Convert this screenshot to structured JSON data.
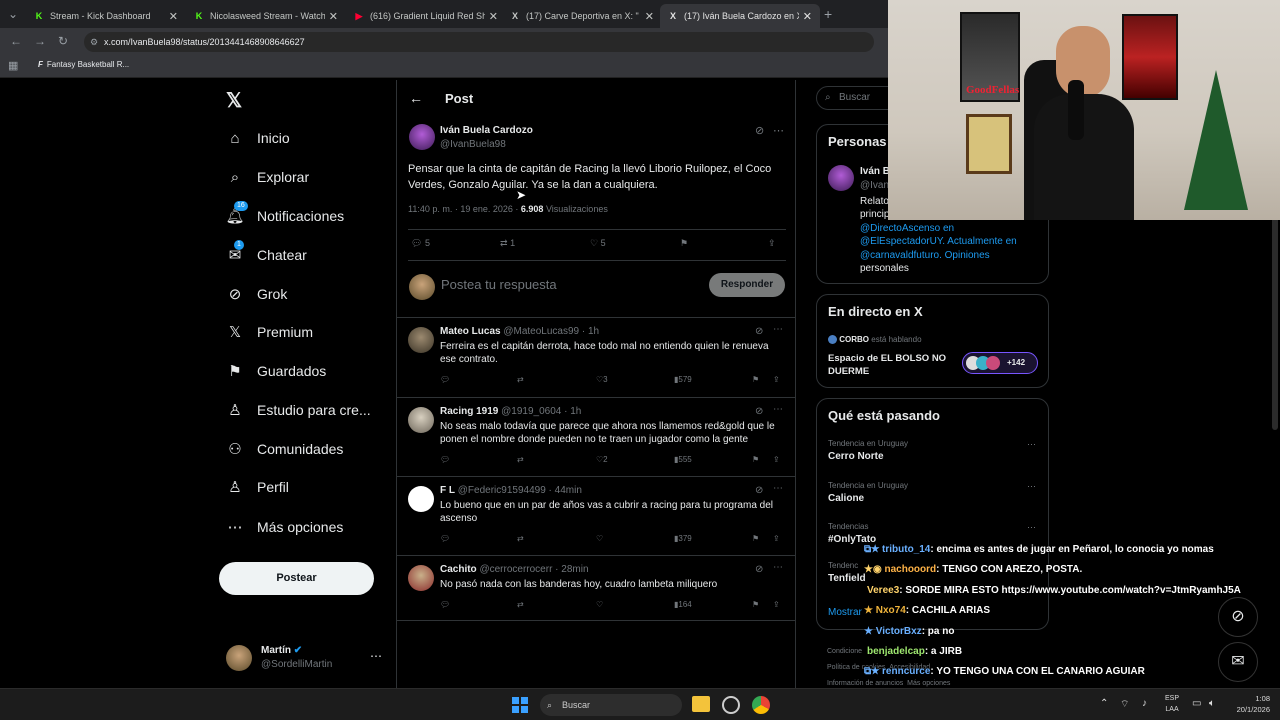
{
  "browser": {
    "tabs": [
      {
        "title": "Stream - Kick Dashboard",
        "fav": "K",
        "color": "#53fc18"
      },
      {
        "title": "Nicolasweed Stream - Watch Li",
        "fav": "K",
        "color": "#53fc18"
      },
      {
        "title": "(616) Gradient Liquid Red Shap",
        "fav": "▶",
        "color": "#ff0033"
      },
      {
        "title": "(17) Carve Deportiva en X: \"",
        "fav": "X",
        "color": "#e7e9ea"
      },
      {
        "title": "(17) Iván Buela Cardozo en X: \"",
        "fav": "X",
        "color": "#e7e9ea"
      }
    ],
    "url": "x.com/IvanBuela98/status/2013441468908646627",
    "bookmark": "Fantasy Basketball R..."
  },
  "nav": {
    "items": [
      {
        "label": "Inicio",
        "icon": "home-icon"
      },
      {
        "label": "Explorar",
        "icon": "search-icon"
      },
      {
        "label": "Notificaciones",
        "icon": "bell-icon",
        "badge": "16"
      },
      {
        "label": "Chatear",
        "icon": "mail-icon",
        "badge": "1"
      },
      {
        "label": "Grok",
        "icon": "grok-icon"
      },
      {
        "label": "Premium",
        "icon": "x-logo-icon"
      },
      {
        "label": "Guardados",
        "icon": "bookmark-icon"
      },
      {
        "label": "Estudio para cre...",
        "icon": "studio-icon"
      },
      {
        "label": "Comunidades",
        "icon": "people-icon"
      },
      {
        "label": "Perfil",
        "icon": "person-icon"
      },
      {
        "label": "Más opciones",
        "icon": "more-circle-icon"
      }
    ],
    "post_button": "Postear",
    "account": {
      "name": "Martín",
      "handle": "@SordelliMartin"
    }
  },
  "post": {
    "header": "Post",
    "author": "Iván Buela Cardozo",
    "handle": "@IvanBuela98",
    "text": "Pensar que la cinta de capitán de Racing la llevó Liborio Ruilopez, el Coco Verdes, Gonzalo Aguilar. Ya se la dan a cualquiera.",
    "time": "11:40 p. m. · 19 ene. 2026 · ",
    "views": "6.908",
    "views_label": "Visualizaciones",
    "replies": "5",
    "reposts": "1",
    "likes": "5",
    "reply_placeholder": "Postea tu respuesta",
    "reply_button": "Responder"
  },
  "replies": [
    {
      "name": "Mateo Lucas",
      "meta": "@MateoLucas99 · 1h",
      "text": "Ferreira es el capitán derrota, hace todo mal no entiendo quien le renueva ese contrato.",
      "likes": "3",
      "views": "579"
    },
    {
      "name": "Racing 1919",
      "meta": "@1919_0604 · 1h",
      "text": "No seas malo todavía que parece que  ahora nos llamemos red&gold que le ponen el nombre donde pueden no te traen un jugador como la gente",
      "likes": "2",
      "views": "555"
    },
    {
      "name": "F L",
      "meta": "@Federic91594499 · 44min",
      "text": "Lo bueno que en un par de años vas a cubrir a racing para tu programa del ascenso",
      "likes": "",
      "views": "379"
    },
    {
      "name": "Cachito",
      "meta": "@cerrocerrocerr · 28min",
      "text": "No pasó nada con las banderas hoy, cuadro lambeta miliquero",
      "likes": "",
      "views": "164"
    }
  ],
  "right": {
    "search_placeholder": "Buscar",
    "persons_title": "Personas relevantes",
    "person_name": "Iván B",
    "person_handle": "@Ivan",
    "bio_lines": [
      "Relato",
      "princip",
      "@DirectoAscenso en",
      "@ElEspectadorUY. Actualmente en",
      "@carnavaldfuturo. Opiniones",
      "personales"
    ],
    "live_title": "En directo en X",
    "live_host": "CORBO",
    "live_status": "está hablando",
    "live_space": "Espacio de EL BOLSO NO DUERME",
    "live_count": "+142",
    "trends_title": "Qué está pasando",
    "trends": [
      {
        "context": "Tendencia en Uruguay",
        "name": "Cerro Norte"
      },
      {
        "context": "Tendencia en Uruguay",
        "name": "Calione"
      },
      {
        "context": "Tendencias",
        "name": "#OnlyTato"
      },
      {
        "context": "Tendenc",
        "name": "Tenfield"
      }
    ],
    "show_more": "Mostrar",
    "footer": [
      "Condicione",
      "Política de cookies",
      "Accesibilidad",
      "Información de anuncios",
      "Más opciones"
    ]
  },
  "chat": [
    {
      "user": "tributo_14",
      "color": "#6ab0ff",
      "msg": ": encima es antes de jugar en Peñarol, lo conocia yo nomas"
    },
    {
      "user": "nachooord",
      "color": "#ffb347",
      "msg": ": TENGO CON AREZO, POSTA."
    },
    {
      "user": "Veree3",
      "color": "#ffd36b",
      "msg": ": SORDE MIRA ESTO https://www.youtube.com/watch?v=JtmRyamhJ5A"
    },
    {
      "user": "Nxo74",
      "color": "#f0b43c",
      "msg": ": CACHILA ARIAS"
    },
    {
      "user": "VictorBxz",
      "color": "#6ab0ff",
      "msg": ": pa no"
    },
    {
      "user": "benjadelcap",
      "color": "#9fe870",
      "msg": ": a JIRB"
    },
    {
      "user": "renncurce",
      "color": "#6ab0ff",
      "msg": ": YO TENGO UNA CON EL CANARIO AGUIAR"
    }
  ],
  "taskbar": {
    "search": "Buscar",
    "lang1": "ESP",
    "lang2": "LAA",
    "time": "1:08",
    "date": "20/1/2026"
  },
  "colors": {
    "accent": "#1d9bf0",
    "kick": "#53fc18"
  }
}
